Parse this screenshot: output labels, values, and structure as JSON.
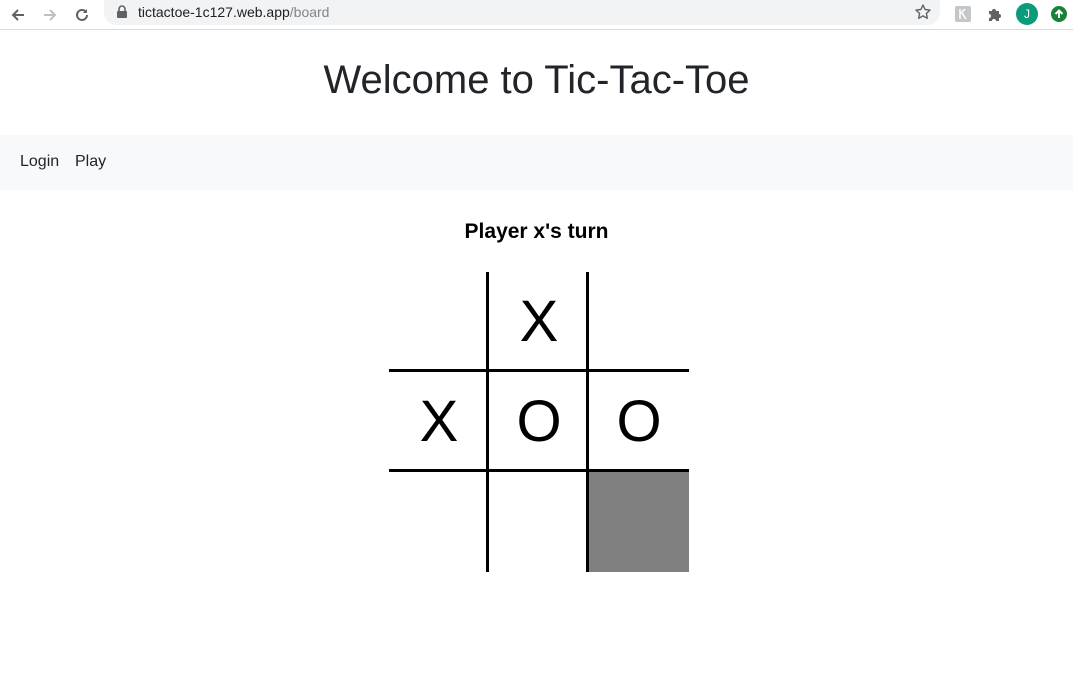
{
  "browser": {
    "url_host": "tictactoe-1c127.web.app",
    "url_path": "/board",
    "profile_initial": "J",
    "icons": {
      "back": "back-arrow-icon",
      "forward": "forward-arrow-icon",
      "reload": "reload-icon",
      "lock": "lock-icon",
      "bookmark": "star-icon",
      "extension1": "extension-icon",
      "extensions": "puzzle-icon",
      "update": "update-arrow-icon"
    },
    "colors": {
      "profile": "#0c9b7a",
      "update": "#188038"
    }
  },
  "header": {
    "title": "Welcome to Tic-Tac-Toe"
  },
  "navbar": {
    "items": [
      {
        "label": "Login"
      },
      {
        "label": "Play"
      }
    ]
  },
  "game": {
    "status": "Player x's turn",
    "board": [
      [
        "",
        "X",
        ""
      ],
      [
        "X",
        "O",
        "O"
      ],
      [
        "",
        "",
        ""
      ]
    ],
    "highlighted_cell": {
      "row": 2,
      "col": 2,
      "color": "#808080"
    }
  }
}
